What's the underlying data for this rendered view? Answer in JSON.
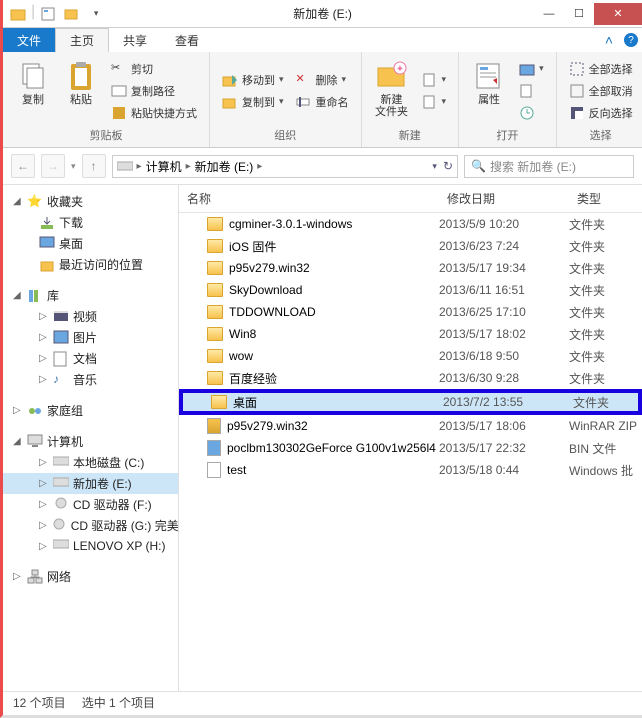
{
  "window": {
    "title": "新加卷 (E:)"
  },
  "qat": {
    "items": [
      "folder-icon",
      "props-icon",
      "new-folder-icon"
    ]
  },
  "ribbon": {
    "tabs": {
      "file": "文件",
      "home": "主页",
      "share": "共享",
      "view": "查看"
    },
    "clipboard": {
      "copy": "复制",
      "paste": "粘贴",
      "cut": "剪切",
      "copy_path": "复制路径",
      "paste_shortcut": "粘贴快捷方式",
      "label": "剪贴板"
    },
    "organize": {
      "move_to": "移动到",
      "copy_to": "复制到",
      "delete": "删除",
      "rename": "重命名",
      "label": "组织"
    },
    "new": {
      "new_folder": "新建\n文件夹",
      "label": "新建"
    },
    "open": {
      "properties": "属性",
      "label": "打开"
    },
    "select": {
      "select_all": "全部选择",
      "select_none": "全部取消",
      "invert": "反向选择",
      "label": "选择"
    }
  },
  "address": {
    "crumbs": [
      "计算机",
      "新加卷 (E:)"
    ],
    "search_placeholder": "搜索 新加卷 (E:)"
  },
  "nav": {
    "favorites": {
      "label": "收藏夹",
      "items": [
        "下载",
        "桌面",
        "最近访问的位置"
      ]
    },
    "libraries": {
      "label": "库",
      "items": [
        "视频",
        "图片",
        "文档",
        "音乐"
      ]
    },
    "homegroup": {
      "label": "家庭组"
    },
    "computer": {
      "label": "计算机",
      "items": [
        "本地磁盘 (C:)",
        "新加卷 (E:)",
        "CD 驱动器 (F:)",
        "CD 驱动器 (G:) 完美",
        "LENOVO XP (H:)"
      ]
    },
    "network": {
      "label": "网络"
    }
  },
  "columns": {
    "name": "名称",
    "date": "修改日期",
    "type": "类型"
  },
  "files": [
    {
      "name": "cgminer-3.0.1-windows",
      "date": "2013/5/9 10:20",
      "type": "文件夹",
      "kind": "folder"
    },
    {
      "name": "iOS 固件",
      "date": "2013/6/23 7:24",
      "type": "文件夹",
      "kind": "folder"
    },
    {
      "name": "p95v279.win32",
      "date": "2013/5/17 19:34",
      "type": "文件夹",
      "kind": "folder"
    },
    {
      "name": "SkyDownload",
      "date": "2013/6/11 16:51",
      "type": "文件夹",
      "kind": "folder"
    },
    {
      "name": "TDDOWNLOAD",
      "date": "2013/6/25 17:10",
      "type": "文件夹",
      "kind": "folder"
    },
    {
      "name": "Win8",
      "date": "2013/5/17 18:02",
      "type": "文件夹",
      "kind": "folder"
    },
    {
      "name": "wow",
      "date": "2013/6/18 9:50",
      "type": "文件夹",
      "kind": "folder"
    },
    {
      "name": "百度经验",
      "date": "2013/6/30 9:28",
      "type": "文件夹",
      "kind": "folder"
    },
    {
      "name": "桌面",
      "date": "2013/7/2 13:55",
      "type": "文件夹",
      "kind": "folder",
      "selected": true,
      "highlighted": true
    },
    {
      "name": "p95v279.win32",
      "date": "2013/5/17 18:06",
      "type": "WinRAR ZIP",
      "kind": "zip"
    },
    {
      "name": "poclbm130302GeForce G100v1w256l4",
      "date": "2013/5/17 22:32",
      "type": "BIN 文件",
      "kind": "bin"
    },
    {
      "name": "test",
      "date": "2013/5/18 0:44",
      "type": "Windows 批",
      "kind": "bat"
    }
  ],
  "status": {
    "count": "12 个项目",
    "selection": "选中 1 个项目"
  }
}
